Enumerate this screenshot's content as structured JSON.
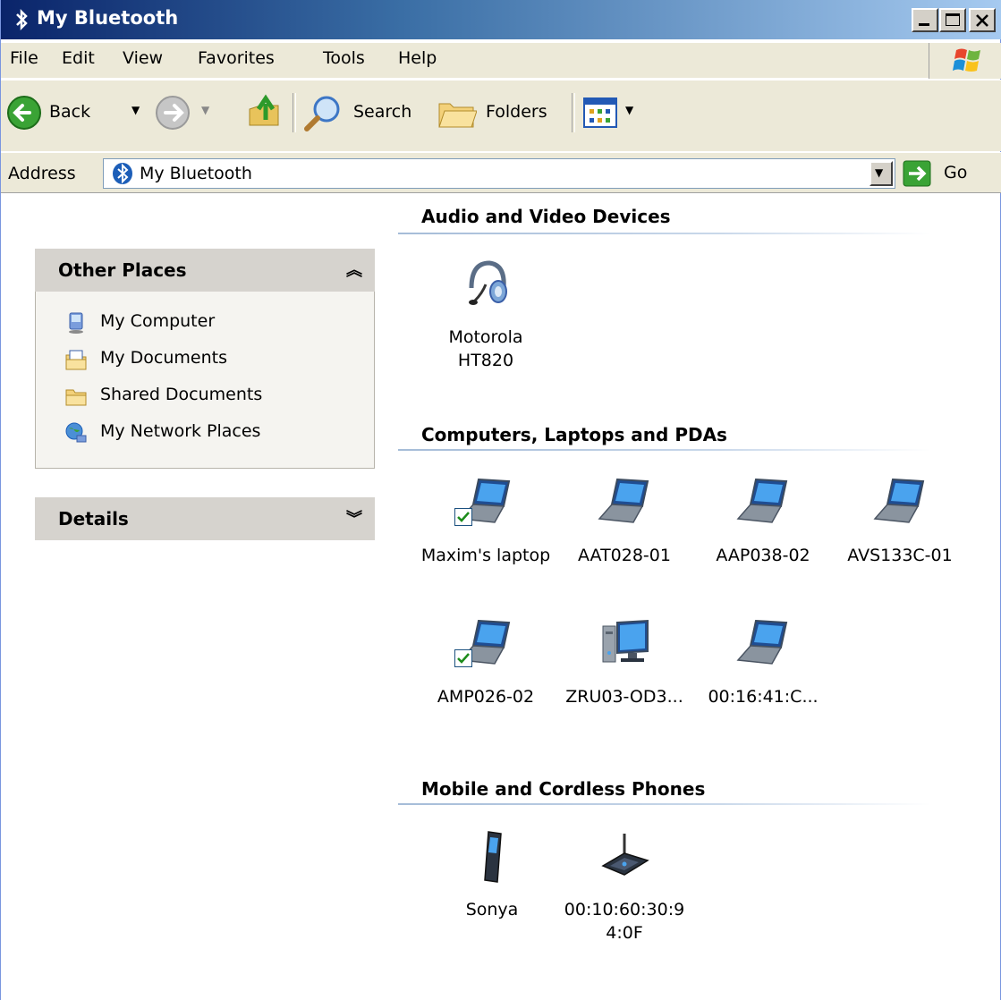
{
  "window": {
    "title": "My Bluetooth"
  },
  "menu": [
    {
      "label": "File"
    },
    {
      "label": "Edit"
    },
    {
      "label": "View"
    },
    {
      "label": "Favorites"
    },
    {
      "label": "Tools"
    },
    {
      "label": "Help"
    }
  ],
  "toolbar": {
    "back_label": "Back",
    "search_label": "Search",
    "folders_label": "Folders"
  },
  "address": {
    "label": "Address",
    "value": "My Bluetooth",
    "go_label": "Go"
  },
  "other_places": {
    "title": "Other Places",
    "items": [
      {
        "label": "My Computer",
        "icon": "computer-icon"
      },
      {
        "label": "My Documents",
        "icon": "documents-icon"
      },
      {
        "label": "Shared Documents",
        "icon": "folder-icon"
      },
      {
        "label": "My Network Places",
        "icon": "network-icon"
      }
    ]
  },
  "details": {
    "title": "Details"
  },
  "groups": {
    "audio": {
      "title": "Audio and Video Devices",
      "devices": [
        {
          "name": "Motorola HT820",
          "icon": "headset-icon",
          "line1": "Motorola",
          "line2": "HT820"
        }
      ]
    },
    "computers": {
      "title": "Computers, Laptops and PDAs",
      "devices": [
        {
          "name": "Maxim's laptop",
          "icon": "laptop-icon",
          "checked": true
        },
        {
          "name": "AAT028-01",
          "icon": "laptop-icon"
        },
        {
          "name": "AAP038-02",
          "icon": "laptop-icon"
        },
        {
          "name": "AVS133C-01",
          "icon": "laptop-icon"
        },
        {
          "name": "AMP026-02",
          "icon": "laptop-icon",
          "checked": true
        },
        {
          "name": "ZRU03-OD3...",
          "icon": "desktop-icon"
        },
        {
          "name": "00:16:41:C...",
          "icon": "laptop-icon"
        }
      ]
    },
    "phones": {
      "title": "Mobile and Cordless Phones",
      "devices": [
        {
          "name": "Sonya",
          "icon": "mobile-phone-icon"
        },
        {
          "name": "00:10:60:30:9 4:0F",
          "icon": "access-point-icon",
          "line1": "00:10:60:30:9",
          "line2": "4:0F"
        }
      ]
    }
  }
}
